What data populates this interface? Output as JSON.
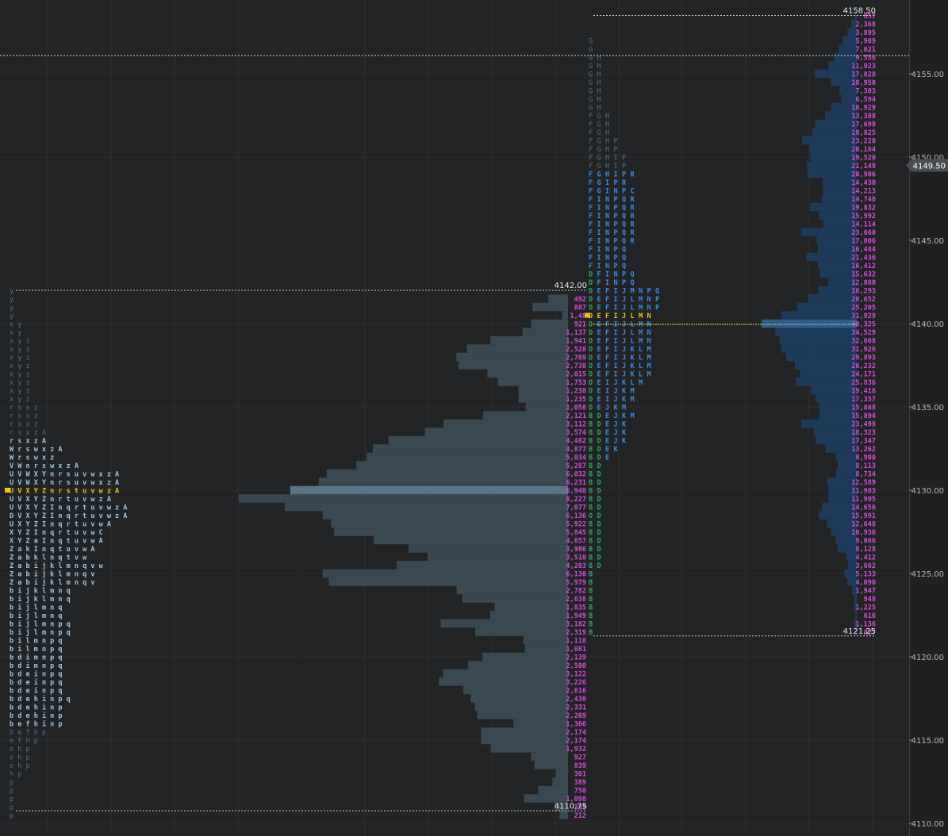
{
  "price_axis": {
    "ticks": [
      "4155.00",
      "4150.00",
      "4145.00",
      "4140.00",
      "4135.00",
      "4130.00",
      "4125.00",
      "4120.00",
      "4115.00",
      "4110.00"
    ],
    "current_price": "4149.50"
  },
  "colors": {
    "background": "#222325",
    "grid": "#2d2e30",
    "tpo_light": "#4f6f8c",
    "tpo_bright": "#9cc8e8",
    "tpo_green": "#2aa860",
    "tpo_blue": "#3b8ee0",
    "poc_yellow": "#f0c419",
    "volume_text": "#d24fd8",
    "profile_fill": "#3a4852",
    "right_profile_fill": "#1e3a5a",
    "current_price_badge": "#4a4d52"
  },
  "chart_data": [
    {
      "type": "tpo_profile",
      "name": "left",
      "prices": [
        4110.5,
        4111,
        4111.5,
        4112,
        4112.5,
        4113,
        4113.5,
        4114,
        4114.5,
        4115,
        4115.5,
        4116,
        4116.5,
        4117,
        4117.5,
        4118,
        4118.5,
        4119,
        4119.5,
        4120,
        4120.5,
        4121,
        4121.5,
        4122,
        4122.5,
        4123,
        4123.5,
        4124,
        4124.5,
        4125,
        4125.5,
        4126,
        4126.5,
        4127,
        4127.5,
        4128,
        4128.5,
        4129,
        4129.5,
        4130,
        4130.5,
        4131,
        4131.5,
        4132,
        4132.5,
        4133,
        4133.5,
        4134,
        4134.5,
        4135,
        4135.5,
        4136,
        4136.5,
        4137,
        4137.5,
        4138,
        4138.5,
        4139,
        4139.5,
        4140,
        4140.5,
        4141,
        4141.5,
        4142
      ],
      "letters": [
        "p",
        "p",
        "p",
        "p",
        "p",
        "hp",
        "ehp",
        "ehp",
        "ehp",
        "efhp",
        "befhp",
        "befhinp",
        "bdehinp",
        "bdehinp",
        "bdehinpq",
        "bdeinpq",
        "bdeinpq",
        "bdeinpq",
        "bdimnpq",
        "bdimnpq",
        "bilmnpq",
        "bilmnpq",
        "bijlmnpq",
        "bijlmnpq",
        "bijlmnq",
        "bijlmnq",
        "bijklmnq",
        "bijklmnq",
        "Zabijklmnqv",
        "Zabijklmnqv",
        "Zabijklmnqvw",
        "Zabklnqtvw",
        "ZakInqtuvwA",
        "XYZaInqtuvwA",
        "XYZInqrtuvwC",
        "UXYZInqrtuvwA",
        "DVXYZInqrtuvwzA",
        "UVXYZInqrtuvwzA",
        "UVXYZnrtuvwzA",
        "UVXYZnrstuvwzA",
        "UVWXYnrsuvwxzA",
        "UVWXYnrsuvwxzA",
        "VWnrswxzA",
        "Wrswxz",
        "WrswxzA",
        "rsxzA",
        "rsxzA",
        "rsxz",
        "rsxz",
        "rsxz",
        "xyz",
        "xyz",
        "xyz",
        "xyz",
        "xyz",
        "xyz",
        "xyz",
        "xyz",
        "xy",
        "xy",
        "y",
        "y",
        "y",
        "y"
      ],
      "poc_price": 4130,
      "high": "4142.00",
      "low": "4110.75",
      "volumes": [
        "212",
        "335",
        "1,098",
        "750",
        "389",
        "301",
        "839",
        "927",
        "1,932",
        "2,174",
        "2,174",
        "1,366",
        "2,269",
        "2,331",
        "2,430",
        "2,616",
        "3,226",
        "3,122",
        "2,500",
        "2,139",
        "1,081",
        "1,118",
        "2,319",
        "3,182",
        "1,949",
        "1,835",
        "2,638",
        "2,782",
        "5,979",
        "6,130",
        "4,283",
        "3,510",
        "3,986",
        "4,857",
        "5,845",
        "5,922",
        "6,136",
        "7,077",
        "8,227",
        "6,940",
        "6,231",
        "6,032",
        "5,287",
        "5,034",
        "4,877",
        "4,482",
        "3,574",
        "3,112",
        "2,121",
        "1,058",
        "1,235",
        "1,238",
        "1,753",
        "2,015",
        "2,738",
        "2,789",
        "2,528",
        "1,941",
        "1,137",
        "921",
        "1,48",
        "887",
        "492"
      ]
    },
    {
      "type": "tpo_profile",
      "name": "right",
      "prices": [
        4121.5,
        4122,
        4122.5,
        4123,
        4123.5,
        4124,
        4124.5,
        4125,
        4125.5,
        4126,
        4126.5,
        4127,
        4127.5,
        4128,
        4128.5,
        4129,
        4129.5,
        4130,
        4130.5,
        4131,
        4131.5,
        4132,
        4132.5,
        4133,
        4133.5,
        4134,
        4134.5,
        4135,
        4135.5,
        4136,
        4136.5,
        4137,
        4137.5,
        4138,
        4138.5,
        4139,
        4139.5,
        4140,
        4140.5,
        4141,
        4141.5,
        4142,
        4142.5,
        4143,
        4143.5,
        4144,
        4144.5,
        4145,
        4145.5,
        4146,
        4146.5,
        4147,
        4147.5,
        4148,
        4148.5,
        4149,
        4149.5,
        4150,
        4150.5,
        4151,
        4151.5,
        4152,
        4152.5,
        4153,
        4153.5,
        4154,
        4154.5,
        4155,
        4155.5,
        4156,
        4156.5,
        4157,
        4157.5,
        4158,
        4158.5
      ],
      "letters": [
        "B",
        "B",
        "B",
        "B",
        "B",
        "B",
        "B",
        "B",
        "BD",
        "BD",
        "BD",
        "BD",
        "BD",
        "BD",
        "OD",
        "BD",
        "BD",
        "BD",
        "BD",
        "BD",
        "BD",
        "BDE",
        "BDEK",
        "BDEJK",
        "BDEJK",
        "BDEJK",
        "BDEJKM",
        "DEJKM",
        "DEIJKM",
        "DEIJKM",
        "DEIJKLM",
        "DEFIJKLM",
        "DEFIJKLM",
        "DEFIJKLM",
        "DEFIJKLM",
        "DEFIJLMN",
        "DEFIJLMN",
        "DEFIJLMN",
        "DEFIJLMN",
        "DEFIJLMNP",
        "DEFIJLMNP",
        "DEFIJMNPQ",
        "DFINPQ",
        "DFINPQ",
        "FINPQ",
        "FINPQ",
        "FINPQ",
        "FINPQR",
        "FINPQR",
        "FINPQR",
        "FINPQR",
        "FINPQR",
        "FINPQR",
        "FGINPC",
        "FGIPR",
        "FGHIPR",
        "FGHIP",
        "FGHIP",
        "FGHP",
        "FGHP",
        "FGH",
        "FGH",
        "FGH",
        "GH",
        "GH",
        "GH",
        "GH",
        "GH",
        "GH",
        "GH",
        "G",
        "G"
      ],
      "poc_price": 4140,
      "high": "4158.50",
      "low": "4121.25",
      "volumes": [
        "827",
        "1,136",
        "616",
        "1,225",
        "948",
        "1,947",
        "4,090",
        "5,133",
        "3,662",
        "4,412",
        "8,128",
        "9,066",
        "10,936",
        "12,648",
        "15,991",
        "14,656",
        "11,905",
        "11,983",
        "12,589",
        "8,734",
        "8,113",
        "8,900",
        "13,262",
        "17,347",
        "18,323",
        "23,498",
        "15,894",
        "15,888",
        "17,357",
        "19,416",
        "25,836",
        "24,171",
        "26,232",
        "29,893",
        "31,926",
        "32,668",
        "34,529",
        "40,325",
        "31,929",
        "25,205",
        "20,652",
        "16,293",
        "12,080",
        "15,632",
        "16,412",
        "21,436",
        "16,484",
        "17,006",
        "23,660",
        "14,114",
        "15,992",
        "19,832",
        "14,740",
        "14,213",
        "14,430",
        "20,906",
        "21,148",
        "19,520",
        "20,164",
        "23,220",
        "18,825",
        "17,699",
        "13,388",
        "10,929",
        "6,594",
        "7,303",
        "10,950",
        "17,828",
        "11,923",
        "9,556",
        "7,621",
        "5,989",
        "3,895",
        "2,368",
        "857"
      ]
    }
  ]
}
